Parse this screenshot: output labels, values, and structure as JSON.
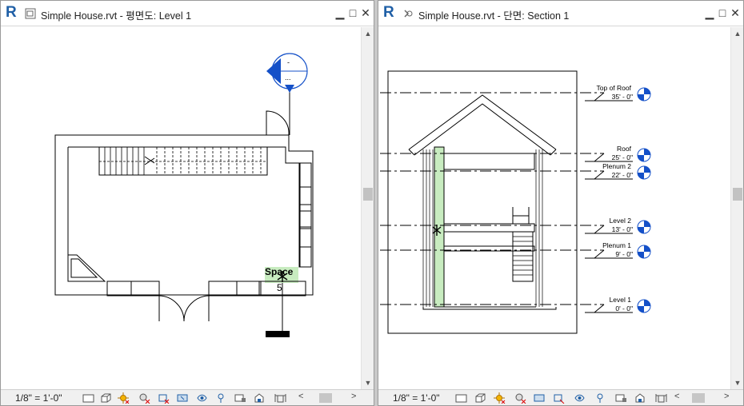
{
  "left_view": {
    "title": "Simple House.rvt - 평면도: Level 1",
    "scale": "1/8\" = 1'-0\"",
    "room_name": "Space",
    "room_number": "5",
    "elevation_marker_top": "-",
    "elevation_marker_bottom": "..."
  },
  "right_view": {
    "title": "Simple House.rvt - 단면: Section 1",
    "scale": "1/8\" = 1'-0\"",
    "levels": [
      {
        "name": "Top of Roof",
        "elevation": "35' - 0\""
      },
      {
        "name": "Roof",
        "elevation": "25' - 0\""
      },
      {
        "name": "Plenum 2",
        "elevation": "22' - 0\""
      },
      {
        "name": "Level 2",
        "elevation": "13' - 0\""
      },
      {
        "name": "Plenum 1",
        "elevation": "9' - 0\""
      },
      {
        "name": "Level 1",
        "elevation": "0' - 0\""
      }
    ]
  },
  "window_controls": {
    "minimize": "▁",
    "maximize": "□",
    "close": "✕"
  },
  "status_icons": [
    "detail-level-icon",
    "visual-style-icon",
    "sun-path-icon",
    "shadows-icon",
    "crop-view-icon",
    "show-crop-icon",
    "temporary-hide-icon",
    "reveal-hidden-icon",
    "temporary-properties-icon",
    "worksharing-icon",
    "design-options-icon",
    "analytical-model-icon",
    "constraints-icon"
  ],
  "colors": {
    "accent_blue": "#1f5fa6",
    "marker_blue": "#1450c8",
    "room_fill": "#c8ecc0"
  }
}
